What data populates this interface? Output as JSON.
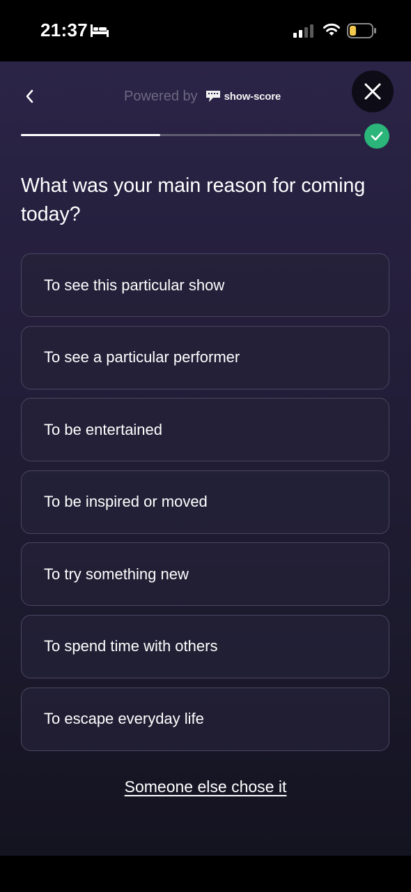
{
  "status_bar": {
    "time": "21:37",
    "icons": [
      "sleep-focus-icon",
      "cellular-signal-icon",
      "wifi-icon",
      "battery-low-icon"
    ]
  },
  "header": {
    "back_icon": "chevron-left-icon",
    "powered_by_text": "Powered by",
    "brand_name": "show-score",
    "close_icon": "close-icon"
  },
  "progress": {
    "fraction": 0.41,
    "complete_icon": "check-circle-icon"
  },
  "question": "What was your main reason for coming today?",
  "options": [
    {
      "label": "To see this particular show"
    },
    {
      "label": "To see a particular performer"
    },
    {
      "label": "To be entertained"
    },
    {
      "label": "To be inspired or moved"
    },
    {
      "label": "To try something new"
    },
    {
      "label": "To spend time with others"
    },
    {
      "label": "To escape everyday life"
    }
  ],
  "alternate_link": "Someone else chose it",
  "colors": {
    "accent_green": "#2bb57a",
    "background": "#231e3a",
    "option_border": "#4a4660",
    "battery_low": "#f2c94c"
  }
}
